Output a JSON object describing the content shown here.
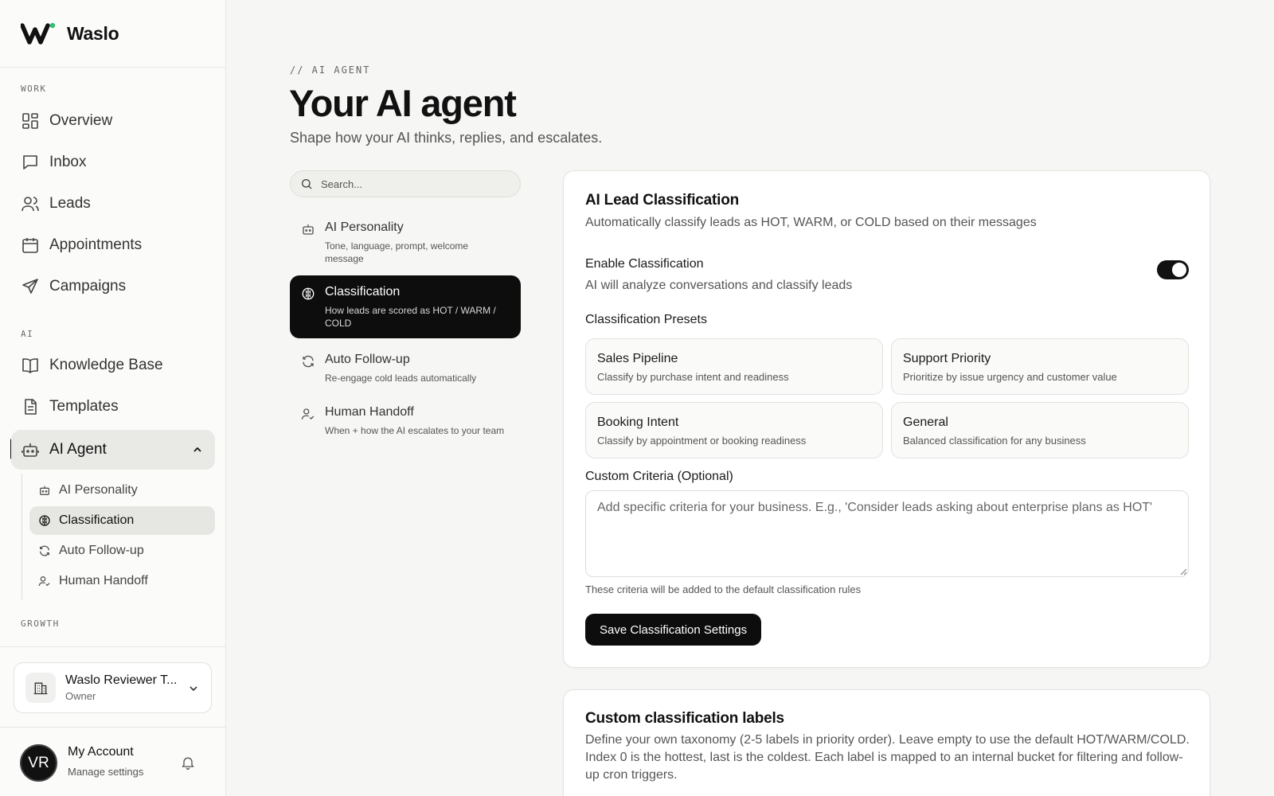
{
  "app": {
    "name": "Waslo"
  },
  "sidebar": {
    "sections": {
      "work": "WORK",
      "ai": "AI",
      "growth": "GROWTH"
    },
    "items": [
      {
        "label": "Overview",
        "icon": "grid-icon"
      },
      {
        "label": "Inbox",
        "icon": "message-icon"
      },
      {
        "label": "Leads",
        "icon": "users-icon"
      },
      {
        "label": "Appointments",
        "icon": "calendar-icon"
      },
      {
        "label": "Campaigns",
        "icon": "send-icon"
      },
      {
        "label": "Knowledge Base",
        "icon": "book-icon"
      },
      {
        "label": "Templates",
        "icon": "document-icon"
      },
      {
        "label": "AI Agent",
        "icon": "bot-icon",
        "active": true
      }
    ],
    "sub_items": [
      {
        "label": "AI Personality",
        "icon": "bot-icon"
      },
      {
        "label": "Classification",
        "icon": "brain-icon",
        "active": true
      },
      {
        "label": "Auto Follow-up",
        "icon": "refresh-icon"
      },
      {
        "label": "Human Handoff",
        "icon": "user-check-icon"
      }
    ],
    "org": {
      "name": "Waslo Reviewer T...",
      "role": "Owner"
    },
    "account": {
      "initials": "VR",
      "name": "My Account",
      "subtitle": "Manage settings"
    }
  },
  "header": {
    "eyebrow": "// AI AGENT",
    "title": "Your AI agent",
    "subtitle": "Shape how your AI thinks, replies, and escalates."
  },
  "search": {
    "placeholder": "Search..."
  },
  "subnav": [
    {
      "title": "AI Personality",
      "desc": "Tone, language, prompt, welcome message"
    },
    {
      "title": "Classification",
      "desc": "How leads are scored as HOT / WARM / COLD",
      "active": true
    },
    {
      "title": "Auto Follow-up",
      "desc": "Re-engage cold leads automatically"
    },
    {
      "title": "Human Handoff",
      "desc": "When + how the AI escalates to your team"
    }
  ],
  "classification_card": {
    "title": "AI Lead Classification",
    "desc": "Automatically classify leads as HOT, WARM, or COLD based on their messages",
    "enable_label": "Enable Classification",
    "enable_helper": "AI will analyze conversations and classify leads",
    "enabled": true,
    "presets_label": "Classification Presets",
    "presets": [
      {
        "title": "Sales Pipeline",
        "desc": "Classify by purchase intent and readiness"
      },
      {
        "title": "Support Priority",
        "desc": "Prioritize by issue urgency and customer value"
      },
      {
        "title": "Booking Intent",
        "desc": "Classify by appointment or booking readiness"
      },
      {
        "title": "General",
        "desc": "Balanced classification for any business"
      }
    ],
    "custom_label": "Custom Criteria (Optional)",
    "custom_placeholder": "Add specific criteria for your business. E.g., 'Consider leads asking about enterprise plans as HOT'",
    "custom_helper": "These criteria will be added to the default classification rules",
    "save_label": "Save Classification Settings"
  },
  "labels_card": {
    "title": "Custom classification labels",
    "desc": "Define your own taxonomy (2-5 labels in priority order). Leave empty to use the default HOT/WARM/COLD. Index 0 is the hottest, last is the coldest. Each label is mapped to an internal bucket for filtering and follow-up cron triggers."
  },
  "colors": {
    "accent": "#0d0d0d",
    "background": "#f6f6f4",
    "card": "#ffffff",
    "logo_dot": "#2fbf71"
  }
}
